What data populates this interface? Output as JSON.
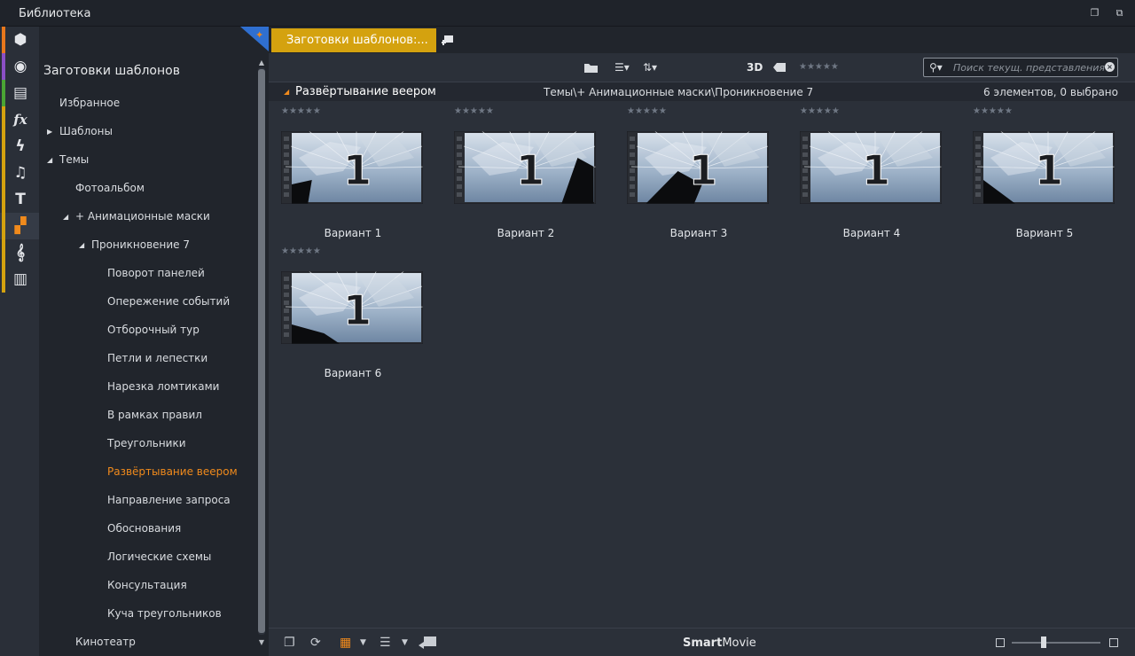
{
  "window": {
    "title": "Библиотека"
  },
  "rail": {
    "items": [
      {
        "icon": "package-icon",
        "stripe": "#e8771c",
        "glyph": "⬢"
      },
      {
        "icon": "film-reel-icon",
        "stripe": "#8b4fc5",
        "glyph": "◉"
      },
      {
        "icon": "photos-icon",
        "stripe": "#4aa534",
        "glyph": "▤"
      },
      {
        "icon": "fx-icon",
        "stripe": "#d4a20f",
        "glyph": "fx"
      },
      {
        "icon": "lightning-icon",
        "stripe": "#d4a20f",
        "glyph": "ϟ"
      },
      {
        "icon": "music-note-icon",
        "stripe": "#d4a20f",
        "glyph": "♫"
      },
      {
        "icon": "title-text-icon",
        "stripe": "#d4a20f",
        "glyph": "T"
      },
      {
        "icon": "montage-templates-icon",
        "stripe": "#d4a20f",
        "glyph": "▞"
      },
      {
        "icon": "treble-clef-icon",
        "stripe": "#d4a20f",
        "glyph": "𝄞"
      },
      {
        "icon": "piano-icon",
        "stripe": "#d4a20f",
        "glyph": "▥"
      }
    ]
  },
  "tree": {
    "root": "Заготовки шаблонов",
    "items": [
      {
        "label": "Избранное",
        "level": 0,
        "arrow": ""
      },
      {
        "label": "Шаблоны",
        "level": 0,
        "arrow": "closed"
      },
      {
        "label": "Темы",
        "level": 0,
        "arrow": "open"
      },
      {
        "label": "Фотоальбом",
        "level": 1,
        "arrow": ""
      },
      {
        "label": "+ Анимационные маски",
        "level": 1,
        "arrow": "open"
      },
      {
        "label": "Проникновение 7",
        "level": 2,
        "arrow": "open"
      },
      {
        "label": "Поворот панелей",
        "level": 3,
        "arrow": ""
      },
      {
        "label": "Опережение событий",
        "level": 3,
        "arrow": ""
      },
      {
        "label": "Отборочный тур",
        "level": 3,
        "arrow": ""
      },
      {
        "label": "Петли и лепестки",
        "level": 3,
        "arrow": ""
      },
      {
        "label": "Нарезка ломтиками",
        "level": 3,
        "arrow": ""
      },
      {
        "label": "В рамках правил",
        "level": 3,
        "arrow": ""
      },
      {
        "label": "Треугольники",
        "level": 3,
        "arrow": ""
      },
      {
        "label": "Развёртывание веером",
        "level": 3,
        "arrow": "",
        "selected": true
      },
      {
        "label": "Направление запроса",
        "level": 3,
        "arrow": ""
      },
      {
        "label": "Обоснования",
        "level": 3,
        "arrow": ""
      },
      {
        "label": "Логические схемы",
        "level": 3,
        "arrow": ""
      },
      {
        "label": "Консультация",
        "level": 3,
        "arrow": ""
      },
      {
        "label": "Куча треугольников",
        "level": 3,
        "arrow": ""
      },
      {
        "label": "Кинотеатр",
        "level": 1,
        "arrow": ""
      }
    ]
  },
  "tabs": {
    "active": "Заготовки шаблонов:..."
  },
  "toolbar": {
    "three_d": "3D",
    "rating_filter": "★★★★★",
    "search_placeholder": "Поиск текущ. представления"
  },
  "group": {
    "name": "Развёртывание веером",
    "path": "Темы\\+ Анимационные маски\\Проникновение 7",
    "count": "6 элементов, 0 выбрано"
  },
  "items": [
    {
      "label": "Вариант 1",
      "rating": "★★★★★",
      "number": "1"
    },
    {
      "label": "Вариант 2",
      "rating": "★★★★★",
      "number": "1"
    },
    {
      "label": "Вариант 3",
      "rating": "★★★★★",
      "number": "1"
    },
    {
      "label": "Вариант 4",
      "rating": "★★★★★",
      "number": "1"
    },
    {
      "label": "Вариант 5",
      "rating": "★★★★★",
      "number": "1"
    },
    {
      "label": "Вариант 6",
      "rating": "★★★★★",
      "number": "1"
    }
  ],
  "bottombar": {
    "brand_bold": "Smart",
    "brand_rest": "Movie"
  },
  "colors": {
    "accent_orange": "#f08a1c",
    "tab_gold": "#d4a20f"
  }
}
